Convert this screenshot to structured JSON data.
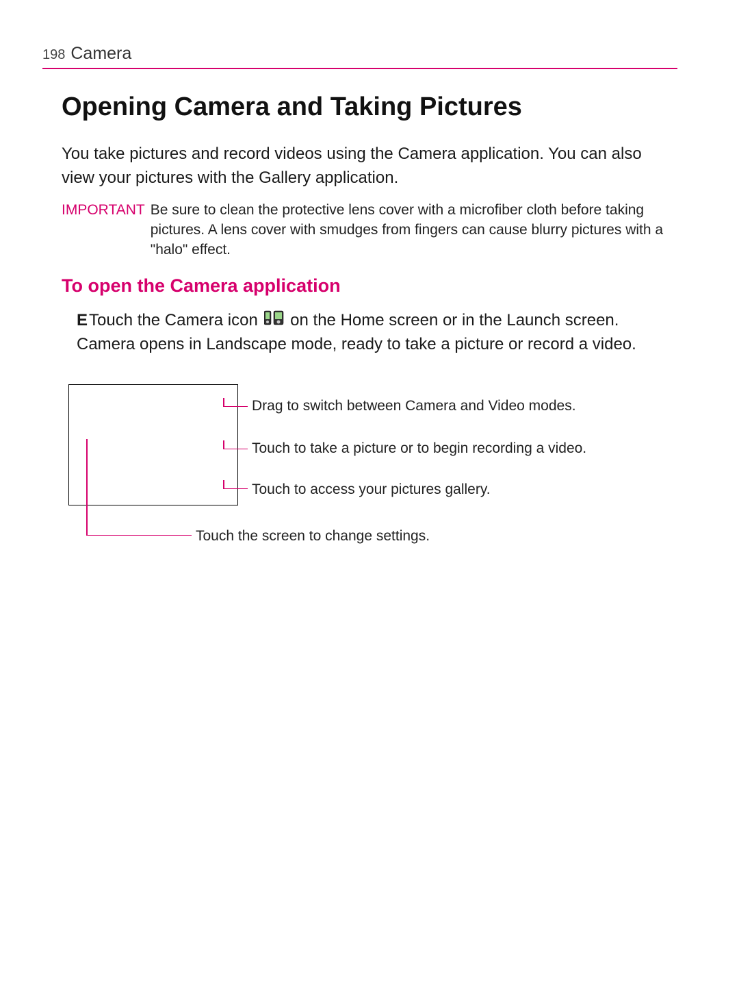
{
  "header": {
    "page_number": "198",
    "section": "Camera"
  },
  "title": "Opening Camera and Taking Pictures",
  "intro": {
    "pre": "You take pictures and record videos using the ",
    "app1": "Camera",
    "mid": " application. You can also view your pictures with the ",
    "app2": "Gallery",
    "post": " application."
  },
  "important": {
    "label": "IMPORTANT",
    "text": "Be sure to clean the protective lens cover with a microfiber cloth before taking pictures. A lens cover with smudges from fingers can cause blurry pictures with a \"halo\" effect."
  },
  "subhead": "To open the Camera application",
  "step": {
    "bullet": "E",
    "pre": "Touch the ",
    "camera_word": "Camera",
    "mid": " icon ",
    "post": " on the Home screen or in the Launch screen.",
    "line2": "Camera opens in Landscape mode, ready to take a picture or record a video."
  },
  "icon_names": {
    "camera_icon": "camera-app-icon"
  },
  "callouts": {
    "c1": "Drag to switch between Camera and Video modes.",
    "c2": "Touch to take a picture or to begin recording a video.",
    "c3": "Touch to access your pictures gallery.",
    "c4": "Touch the screen to change settings."
  },
  "colors": {
    "accent": "#d6006c"
  }
}
